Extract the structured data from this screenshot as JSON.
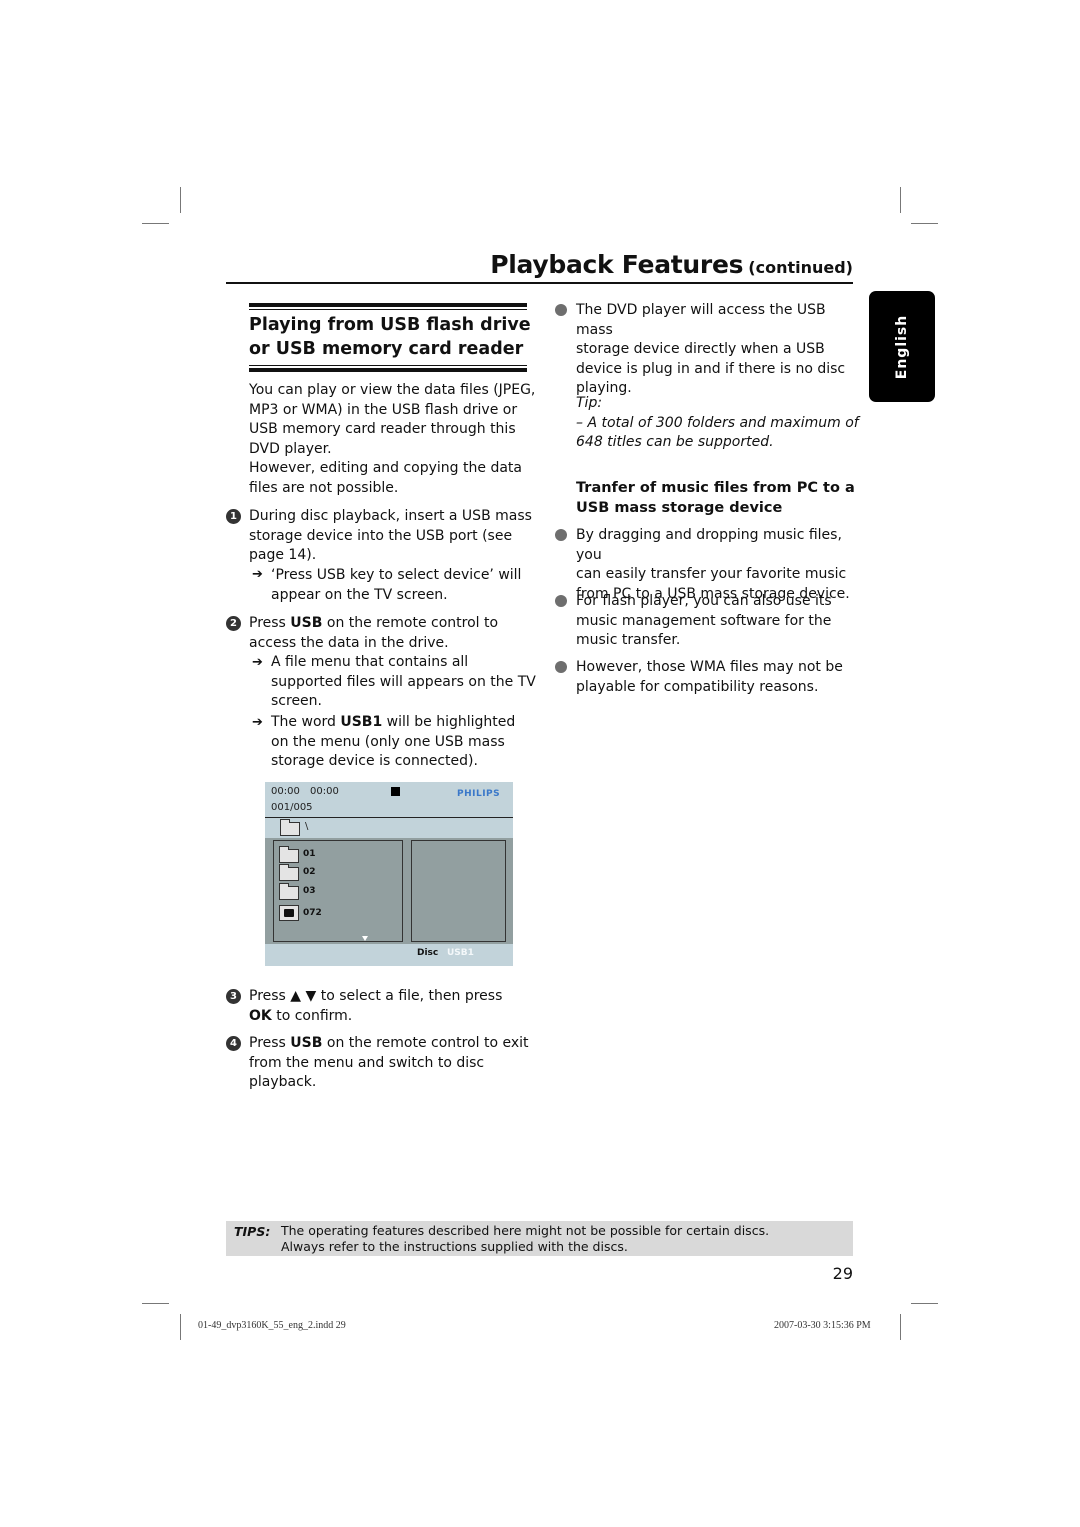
{
  "header": {
    "title": "Playback Features",
    "continued": "(continued)"
  },
  "language_tab": "English",
  "section": {
    "title_line1": "Playing from USB flash drive",
    "title_line2": "or USB memory card reader",
    "intro": [
      "You can play or view the data files (JPEG,",
      "MP3 or WMA) in the USB flash drive or",
      "USB memory card reader through this",
      "DVD player.",
      "However, editing and copying the data",
      "files are not possible."
    ]
  },
  "steps": [
    {
      "number": "1",
      "lines": [
        "During disc playback, insert a USB mass",
        "storage device into the USB port (see",
        "page 14)."
      ],
      "results": [
        {
          "lines": [
            "‘Press USB key to select device’ will",
            "appear on the TV screen."
          ]
        }
      ]
    },
    {
      "number": "2",
      "pre": "Press ",
      "bold": "USB",
      "post": " on the remote control to",
      "line2": "access the data in the drive.",
      "results": [
        {
          "lines": [
            "A file menu that contains all",
            "supported files will appears on the TV",
            "screen."
          ]
        },
        {
          "pre": "The word ",
          "bold": "USB1",
          "post": " will be highlighted",
          "lines": [
            "on the menu (only one USB mass",
            "storage device is connected)."
          ]
        }
      ]
    },
    {
      "number": "3",
      "pre": "Press ",
      "symbols": "▲ ▼",
      "post": " to select a file, then press",
      "bold2": "OK",
      "post2": " to confirm."
    },
    {
      "number": "4",
      "pre": "Press ",
      "bold": "USB",
      "post": " on the remote control to exit",
      "line2": "from the menu and switch to disc",
      "line3": "playback."
    }
  ],
  "tv_screen": {
    "time1": "00:00",
    "time2": "00:00",
    "counter": "001/005",
    "brand": "PHILIPS",
    "path": "\\",
    "items": [
      {
        "icon": "folder-icon",
        "label": "01"
      },
      {
        "icon": "folder-icon",
        "label": "02"
      },
      {
        "icon": "folder-icon",
        "label": "03"
      },
      {
        "icon": "photo-file-icon",
        "label": "072"
      }
    ],
    "footer_disc": "Disc",
    "footer_usb": "USB1",
    "colors": {
      "background": "#c2d3da",
      "panel": "#929fa0",
      "brand": "#3a78c9"
    }
  },
  "right_column": {
    "bullet1": [
      "The DVD player will access the USB mass",
      "storage device directly when a USB",
      "device is plug in and if there is no disc",
      "playing."
    ],
    "tip_label": "Tip:",
    "tip_lines": [
      "– A total of 300 folders and maximum of",
      "648 titles can be supported."
    ],
    "subheading": [
      "Tranfer of music files from PC to a",
      "USB mass storage device"
    ],
    "bullets": [
      [
        "By dragging and dropping music files, you",
        "can easily transfer your favorite music",
        "from PC to a USB mass storage device."
      ],
      [
        "For flash player, you can also use its",
        "music management software for the",
        "music transfer."
      ],
      [
        "However, those WMA files may not be",
        "playable for compatibility reasons."
      ]
    ]
  },
  "tips_box": {
    "label": "TIPS:",
    "line1": "The operating features described here might not be possible for certain discs.",
    "line2": "Always refer to the instructions supplied with the discs."
  },
  "page_number": "29",
  "slug": {
    "file": "01-49_dvp3160K_55_eng_2.indd   29",
    "timestamp": "2007-03-30   3:15:36 PM"
  }
}
